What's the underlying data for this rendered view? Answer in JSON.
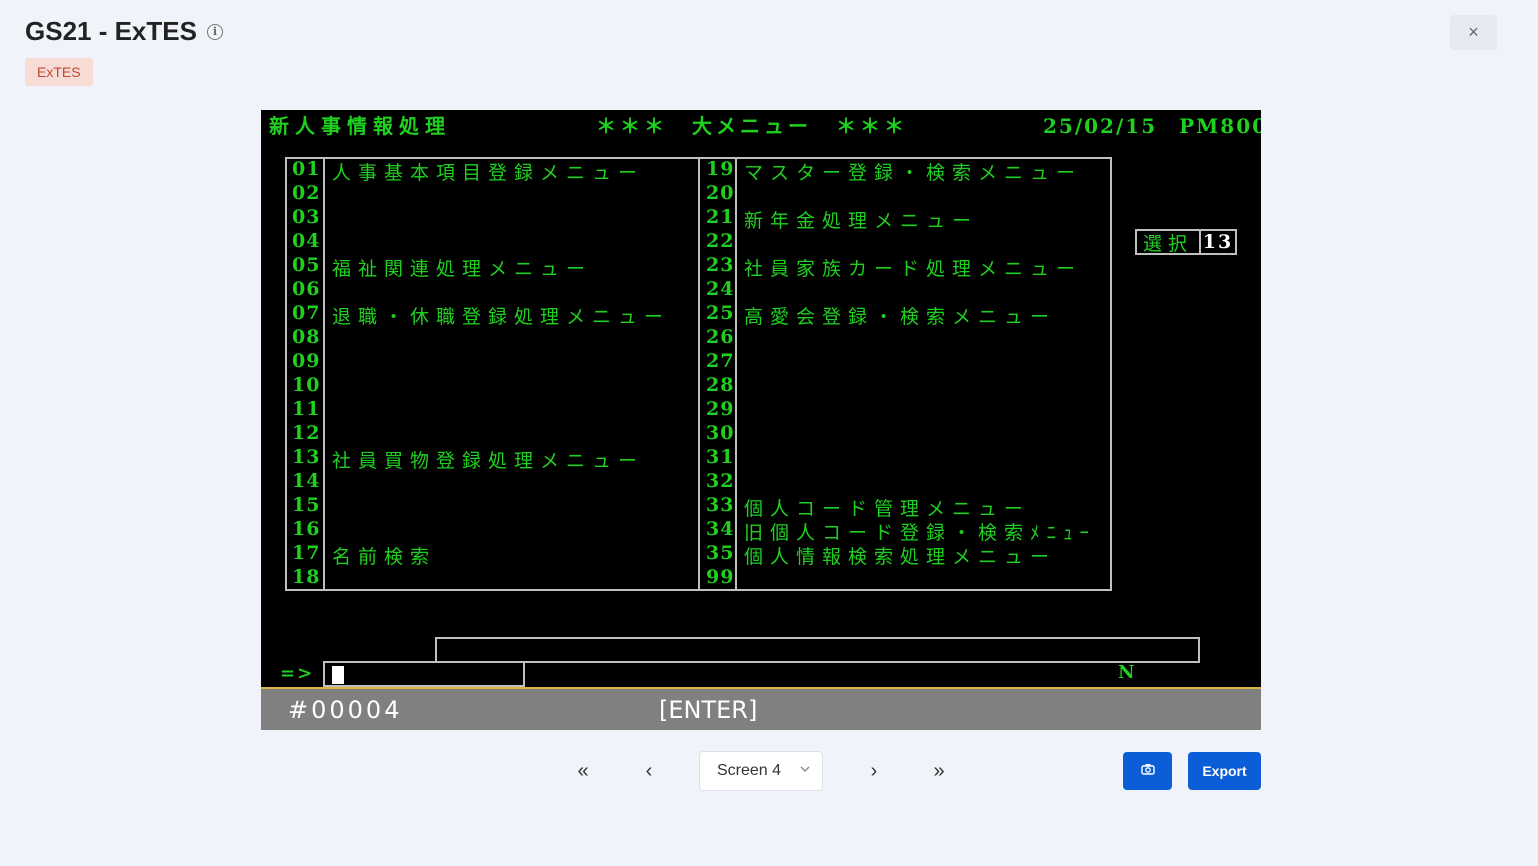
{
  "header": {
    "title": "GS21 - ExTES",
    "tag": "ExTES",
    "close_symbol": "×"
  },
  "terminal": {
    "heading_left": "新人事情報処理",
    "heading_center": "＊＊＊　大メニュー　＊＊＊",
    "heading_right": "25/02/15　PM800",
    "left_rows": [
      {
        "num": "01",
        "label": "人事基本項目登録メニュー"
      },
      {
        "num": "02",
        "label": ""
      },
      {
        "num": "03",
        "label": ""
      },
      {
        "num": "04",
        "label": ""
      },
      {
        "num": "05",
        "label": "福祉関連処理メニュー"
      },
      {
        "num": "06",
        "label": ""
      },
      {
        "num": "07",
        "label": "退職・休職登録処理メニュー"
      },
      {
        "num": "08",
        "label": ""
      },
      {
        "num": "09",
        "label": ""
      },
      {
        "num": "10",
        "label": ""
      },
      {
        "num": "11",
        "label": ""
      },
      {
        "num": "12",
        "label": ""
      },
      {
        "num": "13",
        "label": "社員買物登録処理メニュー"
      },
      {
        "num": "14",
        "label": ""
      },
      {
        "num": "15",
        "label": ""
      },
      {
        "num": "16",
        "label": ""
      },
      {
        "num": "17",
        "label": "名前検索"
      },
      {
        "num": "18",
        "label": ""
      }
    ],
    "right_rows": [
      {
        "num": "19",
        "label": "マスター登録・検索メニュー"
      },
      {
        "num": "20",
        "label": ""
      },
      {
        "num": "21",
        "label": "新年金処理メニュー"
      },
      {
        "num": "22",
        "label": ""
      },
      {
        "num": "23",
        "label": "社員家族カード処理メニュー"
      },
      {
        "num": "24",
        "label": ""
      },
      {
        "num": "25",
        "label": "高愛会登録・検索メニュー"
      },
      {
        "num": "26",
        "label": ""
      },
      {
        "num": "27",
        "label": ""
      },
      {
        "num": "28",
        "label": ""
      },
      {
        "num": "29",
        "label": ""
      },
      {
        "num": "30",
        "label": ""
      },
      {
        "num": "31",
        "label": ""
      },
      {
        "num": "32",
        "label": ""
      },
      {
        "num": "33",
        "label": "個人コード管理メニュー"
      },
      {
        "num": "34",
        "label": "旧個人コード登録・検索ﾒﾆｭｰ"
      },
      {
        "num": "35",
        "label": "個人情報検索処理メニュー"
      },
      {
        "num": "99",
        "label": ""
      }
    ],
    "select_label": "選択",
    "select_value": "13",
    "prompt": "=>",
    "flag": "N",
    "status_left": "#00004",
    "status_center": "[ENTER]"
  },
  "navigation": {
    "first_symbol": "«",
    "prev_symbol": "‹",
    "next_symbol": "›",
    "last_symbol": "»",
    "screen_selected": "Screen 4"
  },
  "actions": {
    "export_label": "Export"
  },
  "icons": {
    "info": "info-icon",
    "close": "close-icon",
    "camera": "camera-icon",
    "chevron": "chevron-down-icon"
  }
}
